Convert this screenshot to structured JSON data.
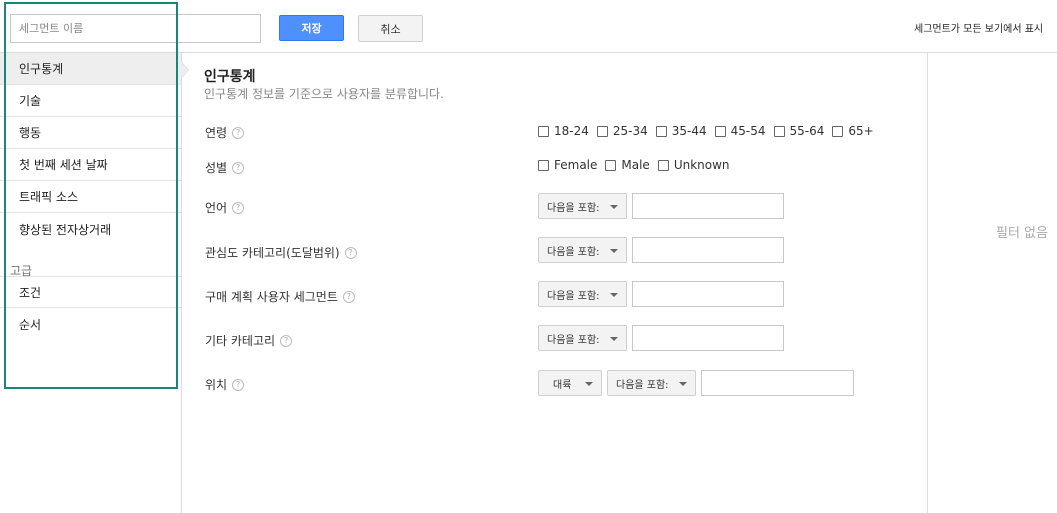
{
  "topbar": {
    "segment_name_placeholder": "세그먼트 이름",
    "save_label": "저장",
    "cancel_label": "취소",
    "note": "세그먼트가 모든 보기에서 표시"
  },
  "sidebar": {
    "items": [
      {
        "label": "인구통계",
        "active": true
      },
      {
        "label": "기술"
      },
      {
        "label": "행동"
      },
      {
        "label": "첫 번째 세션 날짜"
      },
      {
        "label": "트래픽 소스"
      },
      {
        "label": "향상된 전자상거래"
      }
    ],
    "advanced_header": "고급",
    "advanced_items": [
      {
        "label": "조건"
      },
      {
        "label": "순서"
      }
    ]
  },
  "main": {
    "title": "인구통계",
    "subtitle": "인구통계 정보를 기준으로 사용자를 분류합니다.",
    "rows": {
      "age": {
        "label": "연령",
        "options": [
          "18-24",
          "25-34",
          "35-44",
          "45-54",
          "55-64",
          "65+"
        ]
      },
      "gender": {
        "label": "성별",
        "options": [
          "Female",
          "Male",
          "Unknown"
        ]
      },
      "language": {
        "label": "언어",
        "operator": "다음을 포함:"
      },
      "affinity": {
        "label": "관심도 카테고리(도달범위)",
        "operator": "다음을 포함:"
      },
      "in_market": {
        "label": "구매 계획 사용자 세그먼트",
        "operator": "다음을 포함:"
      },
      "other": {
        "label": "기타 카테고리",
        "operator": "다음을 포함:"
      },
      "location": {
        "label": "위치",
        "scope": "대륙",
        "operator": "다음을 포함:"
      }
    },
    "help_glyph": "?"
  },
  "right_panel": {
    "empty_text": "필터 없음"
  },
  "colors": {
    "primary_button": "#4d90fe",
    "highlight_border": "#1a857a"
  }
}
